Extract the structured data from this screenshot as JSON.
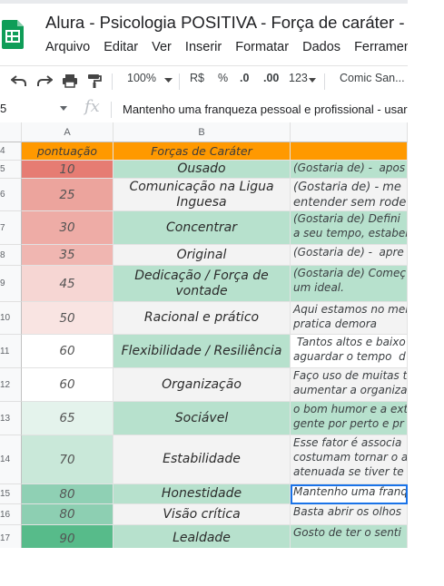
{
  "doc": {
    "title": "Alura - Psicologia POSITIVA  - Força de caráter -",
    "menu": [
      "Arquivo",
      "Editar",
      "Ver",
      "Inserir",
      "Formatar",
      "Dados",
      "Ferramenta"
    ]
  },
  "toolbar": {
    "zoom": "100%",
    "currency": "R$",
    "percent": "%",
    "dec_decrease": ".0",
    "dec_increase": ".00",
    "number_format": "123",
    "font": "Comic San..."
  },
  "formula_bar": {
    "cell_ref": "5",
    "fx": "fx",
    "content": "Mantenho uma franqueza pessoal e profissional - usar"
  },
  "grid": {
    "columns": [
      "A",
      "B"
    ],
    "header_row": {
      "row": "4",
      "a": "pontuação",
      "b": "Forças de Caráter",
      "c": ""
    },
    "rows": [
      {
        "row": "5",
        "score": "10",
        "strength": "Ousado",
        "note": "(Gostaria de) -  apos"
      },
      {
        "row": "6",
        "score": "25",
        "strength": "Comunicação na Ligua Inguesa",
        "note": "(Gostaria de) - me\nentender sem rode"
      },
      {
        "row": "7",
        "score": "30",
        "strength": "Concentrar",
        "note": "(Gostaria de) Defini\na seu tempo, estabel"
      },
      {
        "row": "8",
        "score": "35",
        "strength": "Original",
        "note": "(Gostaria de) -  apre"
      },
      {
        "row": "9",
        "score": "45",
        "strength": "Dedicação / Força de vontade",
        "note": "(Gostaria de) Começ\num ideal."
      },
      {
        "row": "10",
        "score": "50",
        "strength": "Racional e prático",
        "note": "Aqui estamos no mei\npratica demora"
      },
      {
        "row": "11",
        "score": "60",
        "strength": "Flexibilidade / Resiliência",
        "note": " Tantos altos e baixo\naguardar o tempo  d"
      },
      {
        "row": "12",
        "score": "60",
        "strength": "Organização",
        "note": "Faço uso de muitas t\naumentar a organiza"
      },
      {
        "row": "13",
        "score": "65",
        "strength": "Sociável",
        "note": "o bom humor e a ext\ngente por perto e pr"
      },
      {
        "row": "14",
        "score": "70",
        "strength": "Estabilidade",
        "note": "Esse fator é associa\ncostumam tornar o a\natenuada se tiver te"
      },
      {
        "row": "15",
        "score": "80",
        "strength": "Honestidade",
        "note": "Mantenho uma franq"
      },
      {
        "row": "16",
        "score": "80",
        "strength": "Visão crítica",
        "note": "Basta abrir os olhos"
      },
      {
        "row": "17",
        "score": "90",
        "strength": "Lealdade",
        "note": "Gosto de ter o senti"
      }
    ]
  },
  "colors": {
    "header_orange": "#ff9900",
    "selection_blue": "#1a73e8",
    "sheets_green": "#0f9d58"
  }
}
